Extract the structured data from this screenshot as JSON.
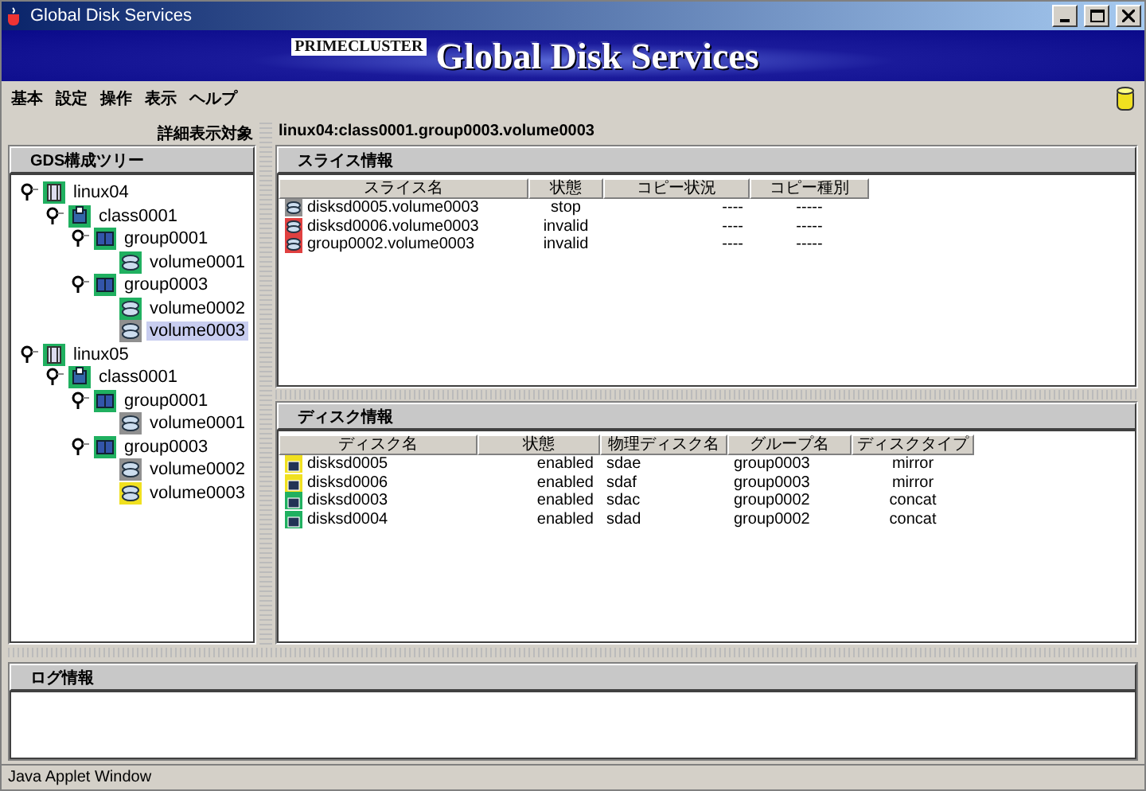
{
  "window": {
    "title": "Global Disk Services"
  },
  "banner": {
    "brand": "PRIMECLUSTER",
    "product": "Global Disk Services"
  },
  "menu": [
    "基本",
    "設定",
    "操作",
    "表示",
    "ヘルプ"
  ],
  "detail_label": "詳細表示対象",
  "tree": {
    "title": "GDS構成ツリー",
    "nodes": [
      {
        "label": "linux04",
        "kind": "host",
        "color": "#20b060",
        "selected": false,
        "children": [
          {
            "label": "class0001",
            "kind": "class",
            "color": "#20b060",
            "selected": false,
            "children": [
              {
                "label": "group0001",
                "kind": "group",
                "color": "#20b060",
                "selected": false,
                "children": [
                  {
                    "label": "volume0001",
                    "kind": "volume",
                    "color": "#20b060",
                    "selected": false
                  }
                ]
              },
              {
                "label": "group0003",
                "kind": "group",
                "color": "#20b060",
                "selected": false,
                "children": [
                  {
                    "label": "volume0002",
                    "kind": "volume",
                    "color": "#20b060",
                    "selected": false
                  },
                  {
                    "label": "volume0003",
                    "kind": "volume",
                    "color": "#909090",
                    "selected": true
                  }
                ]
              }
            ]
          }
        ]
      },
      {
        "label": "linux05",
        "kind": "host",
        "color": "#20b060",
        "selected": false,
        "children": [
          {
            "label": "class0001",
            "kind": "class",
            "color": "#20b060",
            "selected": false,
            "children": [
              {
                "label": "group0001",
                "kind": "group",
                "color": "#20b060",
                "selected": false,
                "children": [
                  {
                    "label": "volume0001",
                    "kind": "volume",
                    "color": "#909090",
                    "selected": false
                  }
                ]
              },
              {
                "label": "group0003",
                "kind": "group",
                "color": "#20b060",
                "selected": false,
                "children": [
                  {
                    "label": "volume0002",
                    "kind": "volume",
                    "color": "#909090",
                    "selected": false
                  },
                  {
                    "label": "volume0003",
                    "kind": "volume",
                    "color": "#f0e020",
                    "selected": false
                  }
                ]
              }
            ]
          }
        ]
      }
    ]
  },
  "path": "linux04:class0001.group0003.volume0003",
  "slice_info": {
    "title": "スライス情報",
    "columns": [
      "スライス名",
      "状態",
      "コピー状況",
      "コピー種別"
    ],
    "rows": [
      {
        "color": "#909090",
        "cells": [
          "disksd0005.volume0003",
          "stop",
          "----",
          "-----"
        ]
      },
      {
        "color": "#e04040",
        "cells": [
          "disksd0006.volume0003",
          "invalid",
          "----",
          "-----"
        ]
      },
      {
        "color": "#e04040",
        "cells": [
          "group0002.volume0003",
          "invalid",
          "----",
          "-----"
        ]
      }
    ]
  },
  "disk_info": {
    "title": "ディスク情報",
    "columns": [
      "ディスク名",
      "状態",
      "物理ディスク名",
      "グループ名",
      "ディスクタイプ"
    ],
    "rows": [
      {
        "color": "#f0e020",
        "cells": [
          "disksd0005",
          "enabled",
          "sdae",
          "group0003",
          "mirror"
        ]
      },
      {
        "color": "#f0e020",
        "cells": [
          "disksd0006",
          "enabled",
          "sdaf",
          "group0003",
          "mirror"
        ]
      },
      {
        "color": "#20b060",
        "cells": [
          "disksd0003",
          "enabled",
          "sdac",
          "group0002",
          "concat"
        ]
      },
      {
        "color": "#20b060",
        "cells": [
          "disksd0004",
          "enabled",
          "sdad",
          "group0002",
          "concat"
        ]
      }
    ]
  },
  "log": {
    "title": "ログ情報"
  },
  "status_bar": "Java Applet Window"
}
